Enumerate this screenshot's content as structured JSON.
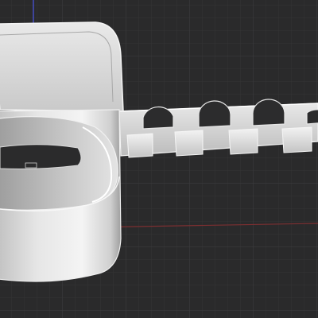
{
  "viewport": {
    "background_color": "#2a2a2b",
    "grid_minor_color": "#353536",
    "grid_major_color": "#3d3d3e",
    "axis_y_color": "#4a55e0",
    "axis_x_color": "#8a3434",
    "model_color": "#d9d9d9",
    "model_outline_color": "#f2f2f2"
  },
  "model": {
    "name_icon": "cad-part-icon",
    "slot_count": 4
  }
}
